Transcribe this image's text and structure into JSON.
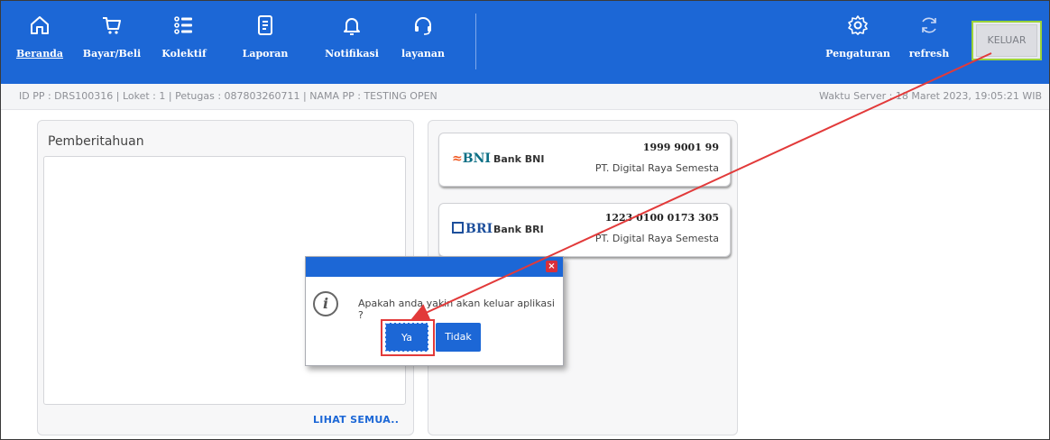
{
  "nav": {
    "items": [
      {
        "label": "Beranda",
        "icon": "home-icon"
      },
      {
        "label": "Bayar/Beli",
        "icon": "cart-icon"
      },
      {
        "label": "Kolektif",
        "icon": "list-icon"
      },
      {
        "label": "Laporan",
        "icon": "document-icon"
      },
      {
        "label": "Notifikasi",
        "icon": "bell-icon"
      },
      {
        "label": "layanan",
        "icon": "headset-icon"
      }
    ],
    "pengaturan": "Pengaturan",
    "refresh": "refresh",
    "keluar": "KELUAR"
  },
  "info": {
    "left": "ID PP : DRS100316 | Loket : 1 | Petugas : 087803260711 | NAMA PP : TESTING OPEN",
    "right": "Waktu Server : 18 Maret 2023, 19:05:21 WIB"
  },
  "notifications": {
    "title": "Pemberitahuan",
    "more": "LIHAT SEMUA.."
  },
  "banks": [
    {
      "logo": "BNI",
      "name": "Bank BNI",
      "number": "1999 9001 99",
      "company": "PT. Digital Raya Semesta"
    },
    {
      "logo": "BRI",
      "name": "Bank BRI",
      "number": "1223 0100 0173 305",
      "company": "PT. Digital Raya Semesta"
    }
  ],
  "dialog": {
    "message": "Apakah anda yakin akan keluar aplikasi ?",
    "yes": "Ya",
    "no": "Tidak"
  },
  "colors": {
    "primary": "#1c67d6",
    "highlight_green": "#9bd33a",
    "annotation_red": "#e23a3a",
    "bni_orange": "#f15a23",
    "bni_teal": "#0c6f85",
    "bri_blue": "#1d4f9c"
  }
}
